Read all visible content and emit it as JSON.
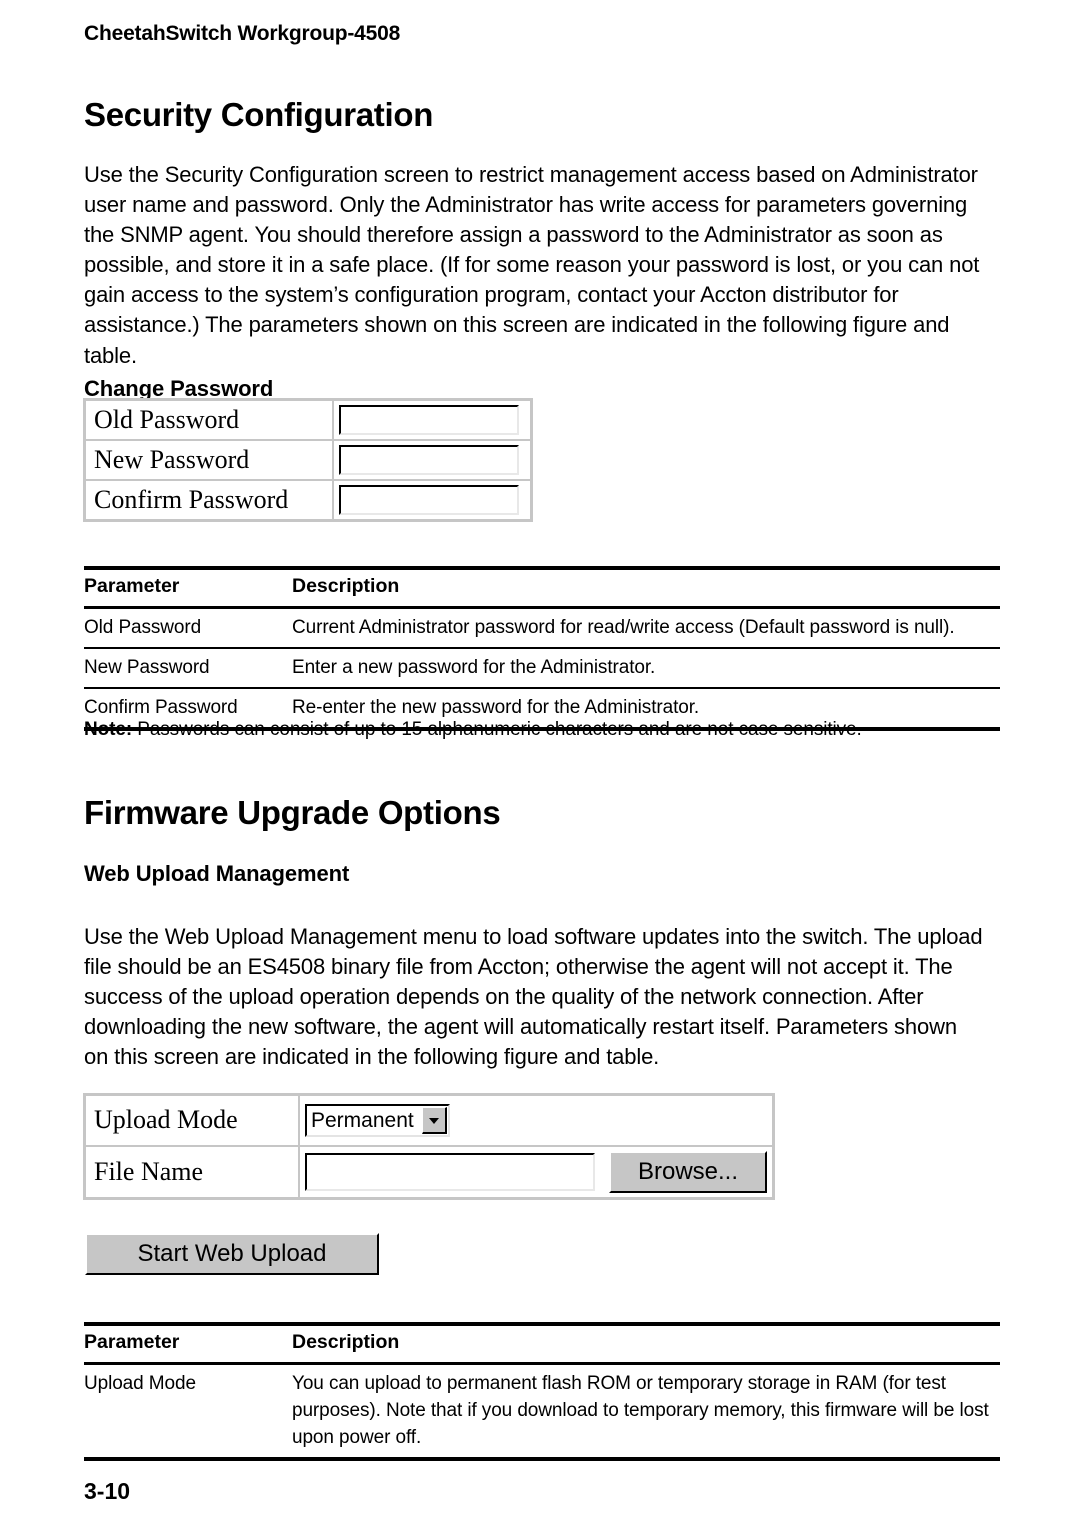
{
  "running_head": "CheetahSwitch Workgroup-4508",
  "folio": "3-10",
  "sections": {
    "security": {
      "heading": "Security Configuration",
      "intro": "Use the Security Configuration screen to restrict management access based on Administrator user name and password. Only the Administrator has write access for parameters governing the SNMP agent. You should therefore assign a password to the Administrator as soon as possible, and store it in a safe place. (If for some reason your password is lost, or you can not gain access to the system’s configuration program, contact your Accton distributor for assistance.) The parameters shown on this screen are indicated in the following figure and table.",
      "subheading": "Change Password",
      "form": {
        "rows": [
          {
            "label": "Old Password",
            "value": "",
            "placeholder": ""
          },
          {
            "label": "New Password",
            "value": "",
            "placeholder": ""
          },
          {
            "label": "Confirm Password",
            "value": "",
            "placeholder": ""
          }
        ]
      },
      "table": {
        "headers": {
          "parameter": "Parameter",
          "description": "Description"
        },
        "rows": [
          {
            "parameter": "Old Password",
            "description": "Current Administrator password for read/write access (Default password is null)."
          },
          {
            "parameter": "New Password",
            "description": "Enter a new password for the Administrator."
          },
          {
            "parameter": "Confirm Password",
            "description": "Re-enter the new password for the Administrator."
          }
        ]
      },
      "note_label": "Note:",
      "note_text": " Passwords can consist of up to 15 alphanumeric characters and are not case sensitive."
    },
    "firmware": {
      "heading": "Firmware Upgrade Options",
      "subheading": "Web Upload Management",
      "intro": "Use the Web Upload Management menu to load software updates into the switch. The upload file should be an ES4508 binary file from Accton; otherwise the agent will not accept it. The success of the upload operation depends on the quality of the network connection. After downloading the new software, the agent will automatically restart itself. Parameters shown on this screen are indicated in the following figure and table.",
      "form": {
        "upload_mode_label": "Upload Mode",
        "upload_mode_value": "Permanent",
        "file_name_label": "File Name",
        "file_name_value": "",
        "browse_label": "Browse...",
        "start_label": "Start Web Upload"
      },
      "table": {
        "headers": {
          "parameter": "Parameter",
          "description": "Description"
        },
        "rows": [
          {
            "parameter": "Upload Mode",
            "description": "You can upload to permanent flash ROM or temporary storage in RAM (for test purposes). Note that if you download to temporary memory, this firmware will be lost upon power off."
          }
        ]
      }
    }
  },
  "colors": {
    "text": "#000000",
    "page_background": "#ffffff",
    "widget_face": "#c6c6c6",
    "widget_border": "#c6c6c6"
  }
}
